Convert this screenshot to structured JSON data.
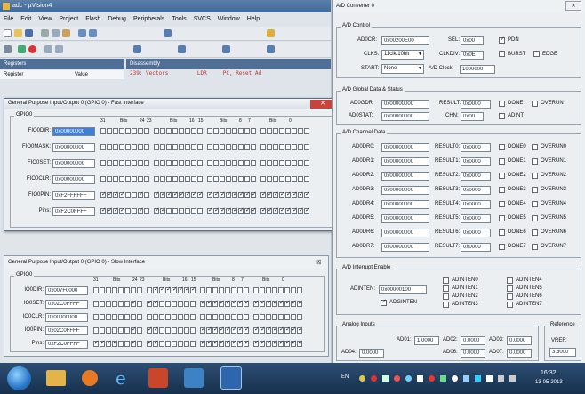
{
  "ide": {
    "title": "adc - µVision4",
    "menu": [
      "File",
      "Edit",
      "View",
      "Project",
      "Flash",
      "Debug",
      "Peripherals",
      "Tools",
      "SVCS",
      "Window",
      "Help"
    ],
    "panel_registers": "Registers",
    "panel_disassembly": "Disassembly",
    "reg_col_register": "Register",
    "reg_col_value": "Value",
    "disasm_line": "239: Vectors         LDR     PC, Reset_Ad"
  },
  "adc": {
    "title": "A/D Converter 0",
    "close_label": "✕",
    "control": {
      "label": "A/D Control",
      "ad0cr_label": "AD0CR:",
      "ad0cr": "0x00200E00",
      "sel_label": "SEL:",
      "sel": "0x00",
      "pdn_label": "PDN",
      "clks_label": "CLKS:",
      "clks": "11clk/10bit",
      "clkdiv_label": "CLKDIV:",
      "clkdiv": "0x0E",
      "burst_label": "BURST",
      "edge_label": "EDGE",
      "start_label": "START:",
      "start": "None",
      "adclock_label": "A/D Clock:",
      "adclock": "1000000"
    },
    "global": {
      "label": "A/D Global Data & Status",
      "ad0gdr_label": "AD0GDR:",
      "ad0gdr": "0x00000000",
      "result_label": "RESULT:",
      "result": "0x0000",
      "done_label": "DONE",
      "overun_label": "OVERUN",
      "ad0stat_label": "AD0STAT:",
      "ad0stat": "0x00000000",
      "chn_label": "CHN:",
      "chn": "0x00",
      "adint_label": "ADINT"
    },
    "channels_label": "A/D Channel Data",
    "channels": [
      {
        "reg": "AD0DR0:",
        "val": "0x00000000",
        "rl": "RESULT0:",
        "rv": "0x0000",
        "done": "DONE0",
        "over": "OVERUN0"
      },
      {
        "reg": "AD0DR1:",
        "val": "0x00000000",
        "rl": "RESULT1:",
        "rv": "0x0000",
        "done": "DONE1",
        "over": "OVERUN1"
      },
      {
        "reg": "AD0DR2:",
        "val": "0x00000000",
        "rl": "RESULT2:",
        "rv": "0x0000",
        "done": "DONE2",
        "over": "OVERUN2"
      },
      {
        "reg": "AD0DR3:",
        "val": "0x00000000",
        "rl": "RESULT3:",
        "rv": "0x0000",
        "done": "DONE3",
        "over": "OVERUN3"
      },
      {
        "reg": "AD0DR4:",
        "val": "0x00000000",
        "rl": "RESULT4:",
        "rv": "0x0000",
        "done": "DONE4",
        "over": "OVERUN4"
      },
      {
        "reg": "AD0DR5:",
        "val": "0x00000000",
        "rl": "RESULT5:",
        "rv": "0x0000",
        "done": "DONE5",
        "over": "OVERUN5"
      },
      {
        "reg": "AD0DR6:",
        "val": "0x00000000",
        "rl": "RESULT6:",
        "rv": "0x0000",
        "done": "DONE6",
        "over": "OVERUN6"
      },
      {
        "reg": "AD0DR7:",
        "val": "0x00000000",
        "rl": "RESULT7:",
        "rv": "0x0000",
        "done": "DONE7",
        "over": "OVERUN7"
      }
    ],
    "interrupt": {
      "label": "A/D Interrupt Enable",
      "adinten_label": "ADINTEN:",
      "adinten": "0x00000100",
      "enables": [
        "ADINTEN0",
        "ADINTEN1",
        "ADINTEN2",
        "ADINTEN3",
        "ADINTEN4",
        "ADINTEN5",
        "ADINTEN6",
        "ADINTEN7"
      ],
      "adginten_label": "ADGINTEN"
    },
    "analog": {
      "label": "Analog Inputs",
      "ad01_label": "AD01:",
      "ad01": "1.0000",
      "ad02_label": "AD02:",
      "ad02": "0.0000",
      "ad03_label": "AD03:",
      "ad03": "0.0000",
      "ad04_label": "AD04:",
      "ad04": "0.0000",
      "ad06_label": "AD06:",
      "ad06": "0.0000",
      "ad07_label": "AD07:",
      "ad07": "0.0000"
    },
    "reference": {
      "label": "Reference",
      "vref_label": "VREF:",
      "vref": "3.3000"
    }
  },
  "gpio_fast": {
    "title": "General Purpose Input/Output 0 (GPIO 0) - Fast Interface",
    "close_label": "✕",
    "group_label": "GPIO0",
    "bit_header": [
      "31",
      "Bits",
      "24",
      "23",
      "Bits",
      "16",
      "15",
      "Bits",
      "8",
      "7",
      "Bits",
      "0"
    ],
    "rows": [
      {
        "label": "FIO0DIR:",
        "value": "0x00000000"
      },
      {
        "label": "FIO0MASK:",
        "value": "0x00000000"
      },
      {
        "label": "FIO0SET:",
        "value": "0x00000000"
      },
      {
        "label": "FIO0CLR:",
        "value": "0x00000000"
      },
      {
        "label": "FIO0PIN:",
        "value": "0xF2FFFFFF"
      },
      {
        "label": "Pins:",
        "value": "0xF2C0FFFF"
      }
    ]
  },
  "gpio_slow": {
    "title": "General Purpose Input/Output 0 (GPIO 0) - Slow Interface",
    "close_label": "⊠",
    "group_label": "GPIO0",
    "bit_header": [
      "31",
      "Bits",
      "24",
      "23",
      "Bits",
      "16",
      "15",
      "Bits",
      "8",
      "7",
      "Bits",
      "0"
    ],
    "rows": [
      {
        "label": "IO0DIR:",
        "value": "0x007F0000"
      },
      {
        "label": "IO0SET:",
        "value": "0x02C0FFFF"
      },
      {
        "label": "IO0CLR:",
        "value": "0x00000000"
      },
      {
        "label": "IO0PIN:",
        "value": "0x02C0FFFF"
      },
      {
        "label": "Pins:",
        "value": "0xF2C0FFFF"
      }
    ]
  },
  "taskbar": {
    "lang": "EN",
    "time": "16:32",
    "date": "13-05-2013",
    "colors": {
      "bar": "#1f3a5a",
      "start": "#3b8ee0"
    }
  }
}
